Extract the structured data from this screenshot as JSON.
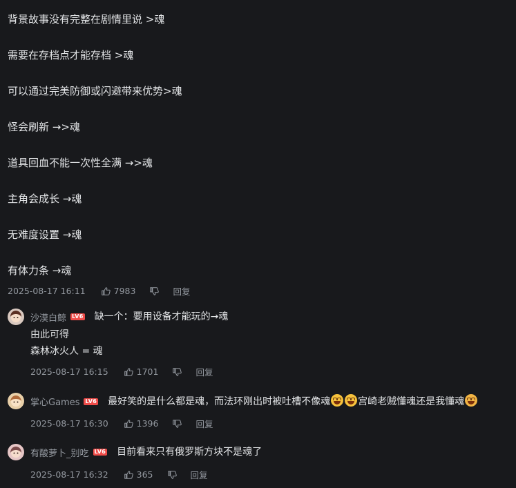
{
  "main_comment": {
    "lines": [
      "背景故事没有完整在剧情里说 >魂",
      "需要在存档点才能存档 >魂",
      "可以通过完美防御或闪避带来优势>魂",
      "怪会刷新 →>魂",
      "道具回血不能一次性全满 →>魂",
      "主角会成长 →魂",
      "无难度设置 →魂",
      "有体力条 →魂"
    ],
    "time": "2025-08-17 16:11",
    "likes": "7983",
    "reply_label": "回复"
  },
  "replies": [
    {
      "username": "沙漠白鲸",
      "level": "LV6",
      "lines": [
        "缺一个：要用设备才能玩的→魂",
        "由此可得",
        "森林冰火人 = 魂"
      ],
      "time": "2025-08-17 16:15",
      "likes": "1701",
      "reply_label": "回复"
    },
    {
      "username": "掌心Games",
      "level": "LV6",
      "text_a": "最好笑的是什么都是魂，而法环刚出时被吐槽不像魂",
      "text_b": "宫崎老贼懂魂还是我懂魂",
      "emojis": [
        "laugh-cry-emoji",
        "laugh-cry-emoji",
        "cat-emoji"
      ],
      "time": "2025-08-17 16:30",
      "likes": "1396",
      "reply_label": "回复"
    },
    {
      "username": "有酸萝卜_别吃",
      "level": "LV6",
      "lines": [
        "目前看来只有俄罗斯方块不是魂了"
      ],
      "time": "2025-08-17 16:32",
      "likes": "365",
      "reply_label": "回复"
    }
  ],
  "colors": {
    "background": "#18191c",
    "text": "#e3e5e7",
    "meta": "#9499a0",
    "level_badge": "#f04c49"
  }
}
